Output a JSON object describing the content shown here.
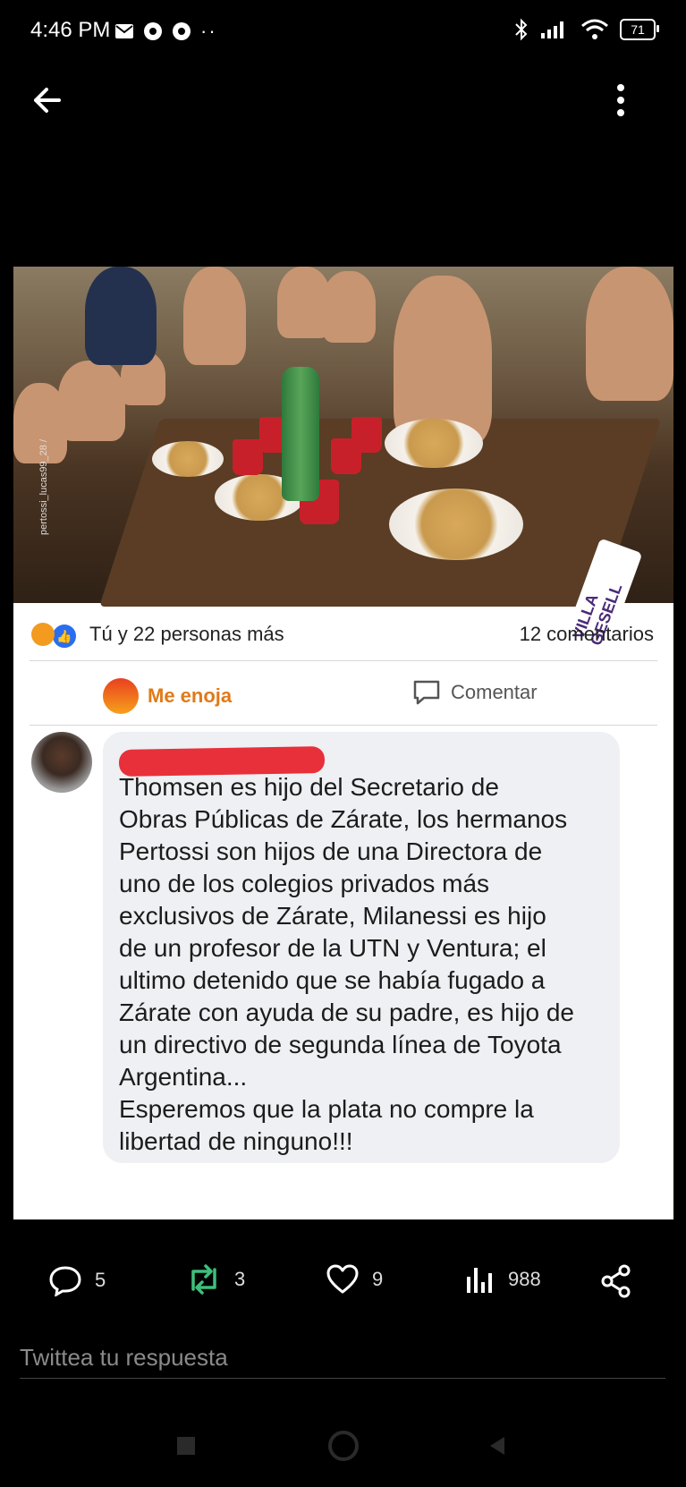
{
  "status_bar": {
    "time": "4:46 PM",
    "battery": "71"
  },
  "post": {
    "photo_overlay_label": "VILLA GESELL",
    "photo_watermark": "pertossi_lucas99_28 /",
    "reactions_text": "Tú y 22 personas más",
    "comments_count": "12 comentarios",
    "action_angry": "Me enoja",
    "action_comment": "Comentar",
    "comment_text": "Thomsen es hijo del Secretario de\nObras Públicas de Zárate, los hermanos\nPertossi son hijos de una Directora de\nuno de los colegios privados más\nexclusivos de Zárate, Milanessi es hijo\nde un profesor de la UTN y Ventura; el\nultimo detenido que se había fugado a\nZárate con ayuda de su padre, es hijo de\nun directivo de segunda línea de Toyota\nArgentina...\nEsperemos que la plata no compre la\nlibertad de ninguno!!!"
  },
  "tweet_actions": {
    "replies": "5",
    "retweets": "3",
    "likes": "9",
    "views": "988"
  },
  "reply_placeholder": "Twittea tu respuesta",
  "colors": {
    "retweet_green": "#3dbf7a",
    "angry_orange": "#e07a18"
  }
}
